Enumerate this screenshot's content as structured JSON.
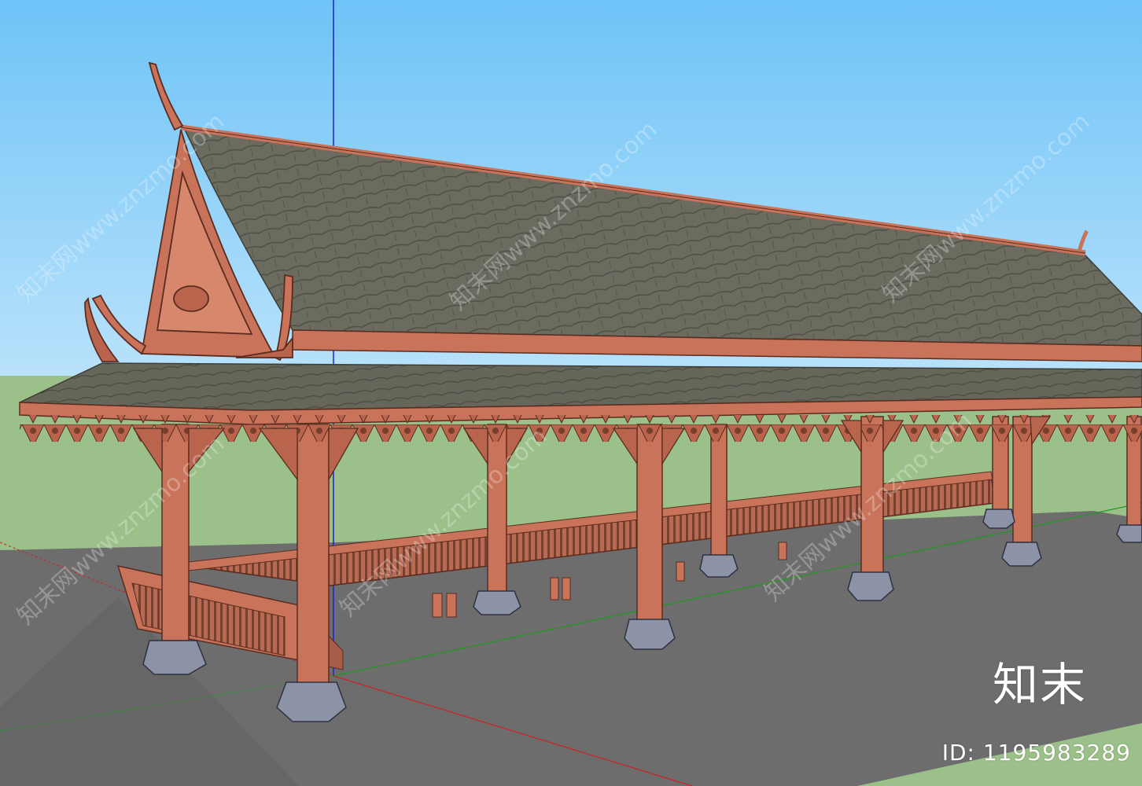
{
  "scene": {
    "description_free": true,
    "colors": {
      "sky_top": "#6ec3f7",
      "sky_bottom": "#b9e2fb",
      "grass": "#9cc08a",
      "ground": "#6d6d6d",
      "wood": "#c8735a",
      "wood_dark": "#8e4a36",
      "roof": "#6a6a5e",
      "stone": "#8d93a6",
      "axis_red": "#d02020",
      "axis_green": "#1c9a1c",
      "axis_blue": "#2020d0"
    }
  },
  "watermark": {
    "logo_text": "知末",
    "id_text": "ID: 1195983289",
    "tiled_text": "知末网www.znzmo.com"
  }
}
